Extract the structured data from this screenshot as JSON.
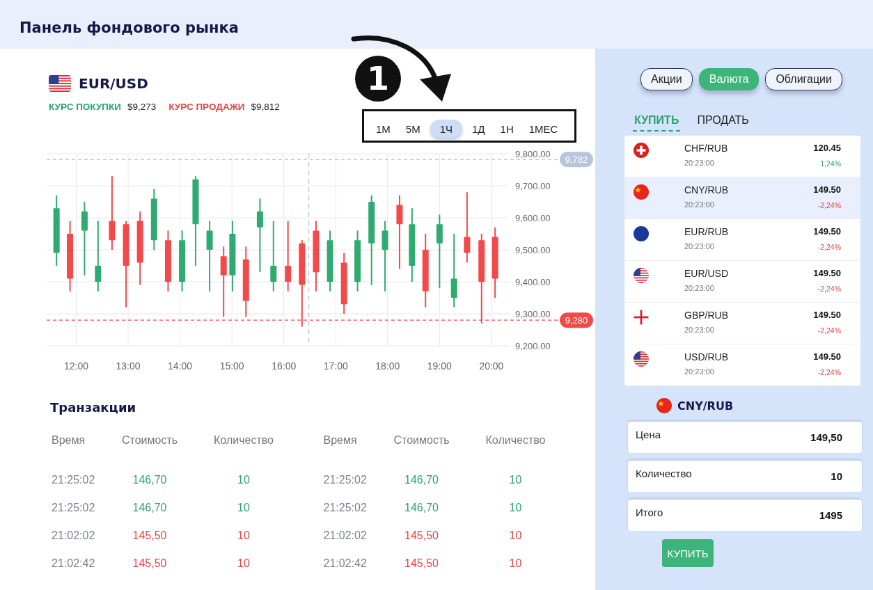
{
  "header": {
    "title": "Панель фондового рынка"
  },
  "instrument": {
    "pair": "EUR/USD",
    "kind": "us",
    "buy_label": "КУРС ПОКУПКИ",
    "buy_rate": "$9,273",
    "sell_label": "КУРС ПРОДАЖИ",
    "sell_rate": "$9,812"
  },
  "callout": {
    "number": "1"
  },
  "timeframes": [
    {
      "label": "1М",
      "selected": false
    },
    {
      "label": "5М",
      "selected": false
    },
    {
      "label": "1Ч",
      "selected": true
    },
    {
      "label": "1Д",
      "selected": false
    },
    {
      "label": "1Н",
      "selected": false
    },
    {
      "label": "1МЕС",
      "selected": false
    }
  ],
  "chart": {
    "chart_data": {
      "type": "candlestick",
      "x": [
        11.62,
        11.88,
        12.16,
        12.42,
        12.69,
        12.96,
        13.23,
        13.5,
        13.77,
        14.04,
        14.3,
        14.57,
        14.84,
        15.01,
        15.27,
        15.54,
        15.8,
        16.08,
        16.35,
        16.62,
        16.89,
        17.16,
        17.42,
        17.69,
        17.95,
        18.23,
        18.47,
        18.73,
        19.0,
        19.28,
        19.53,
        19.81,
        20.07
      ],
      "ohlc": [
        [
          9490,
          9670,
          9450,
          9630
        ],
        [
          9550,
          9590,
          9370,
          9410
        ],
        [
          9560,
          9650,
          9420,
          9620
        ],
        [
          9400,
          9590,
          9370,
          9450
        ],
        [
          9590,
          9730,
          9500,
          9530
        ],
        [
          9580,
          9590,
          9320,
          9450
        ],
        [
          9590,
          9620,
          9390,
          9460
        ],
        [
          9530,
          9690,
          9500,
          9660
        ],
        [
          9530,
          9560,
          9370,
          9400
        ],
        [
          9400,
          9560,
          9370,
          9530
        ],
        [
          9580,
          9730,
          9450,
          9720
        ],
        [
          9500,
          9590,
          9370,
          9560
        ],
        [
          9480,
          9510,
          9290,
          9420
        ],
        [
          9420,
          9590,
          9370,
          9550
        ],
        [
          9470,
          9510,
          9290,
          9340
        ],
        [
          9570,
          9660,
          9430,
          9620
        ],
        [
          9400,
          9590,
          9370,
          9450
        ],
        [
          9450,
          9590,
          9370,
          9400
        ],
        [
          9520,
          9530,
          9260,
          9390
        ],
        [
          9560,
          9590,
          9370,
          9430
        ],
        [
          9400,
          9560,
          9370,
          9530
        ],
        [
          9460,
          9490,
          9300,
          9330
        ],
        [
          9400,
          9560,
          9370,
          9530
        ],
        [
          9520,
          9670,
          9390,
          9650
        ],
        [
          9500,
          9590,
          9370,
          9560
        ],
        [
          9640,
          9670,
          9440,
          9580
        ],
        [
          9450,
          9630,
          9400,
          9580
        ],
        [
          9500,
          9550,
          9320,
          9370
        ],
        [
          9520,
          9610,
          9380,
          9580
        ],
        [
          9350,
          9550,
          9320,
          9410
        ],
        [
          9540,
          9680,
          9460,
          9490
        ],
        [
          9530,
          9550,
          9270,
          9400
        ],
        [
          9540,
          9570,
          9350,
          9410
        ]
      ],
      "xlim": [
        11.43,
        20.35
      ],
      "ylim": [
        9200,
        9800
      ],
      "grid": true,
      "xticks": [
        {
          "value": 12,
          "label": "12:00"
        },
        {
          "value": 13,
          "label": "13:00"
        },
        {
          "value": 14,
          "label": "14:00"
        },
        {
          "value": 15,
          "label": "15:00"
        },
        {
          "value": 16,
          "label": "16:00"
        },
        {
          "value": 17,
          "label": "17:00"
        },
        {
          "value": 18,
          "label": "18:00"
        },
        {
          "value": 19,
          "label": "19:00"
        },
        {
          "value": 20,
          "label": "20:00"
        }
      ],
      "yticks": [
        {
          "value": 9200,
          "label": "9,200.00"
        },
        {
          "value": 9300,
          "label": "9,300.00"
        },
        {
          "value": 9400,
          "label": "9,400.00"
        },
        {
          "value": 9500,
          "label": "9,500.00"
        },
        {
          "value": 9600,
          "label": "9,600.00"
        },
        {
          "value": 9700,
          "label": "9,700.00"
        },
        {
          "value": 9800,
          "label": "9,800.00"
        }
      ],
      "ref_lines": [
        {
          "axis": "y",
          "value": 9782,
          "label": "9,782",
          "color": "#b9c5dd"
        },
        {
          "axis": "y",
          "value": 9280,
          "label": "9,280",
          "color": "#f24a4a"
        },
        {
          "axis": "x",
          "value": 16.48,
          "color": "#c8ccd6"
        }
      ]
    }
  },
  "transactions": {
    "title": "Транзакции",
    "tables": [
      {
        "columns": [
          "Время",
          "Стоимость",
          "Количество"
        ],
        "rows": [
          {
            "time": "21:25:02",
            "price": "146,70",
            "quantity": "10",
            "kind": "buy"
          },
          {
            "time": "21:25:02",
            "price": "146,70",
            "quantity": "10",
            "kind": "buy"
          },
          {
            "time": "21:02:02",
            "price": "145,50",
            "quantity": "10",
            "kind": "sell"
          },
          {
            "time": "21:02:42",
            "price": "145,50",
            "quantity": "10",
            "kind": "sell"
          }
        ]
      },
      {
        "columns": [
          "Время",
          "Стоимость",
          "Количество"
        ],
        "rows": [
          {
            "time": "21:25:02",
            "price": "146,70",
            "quantity": "10",
            "kind": "buy"
          },
          {
            "time": "21:25:02",
            "price": "146,70",
            "quantity": "10",
            "kind": "buy"
          },
          {
            "time": "21:02:02",
            "price": "145,50",
            "quantity": "10",
            "kind": "sell"
          },
          {
            "time": "21:02:42",
            "price": "145,50",
            "quantity": "10",
            "kind": "sell"
          }
        ]
      }
    ]
  },
  "market_tabs": [
    {
      "label": "Акции",
      "selected": false
    },
    {
      "label": "Валюта",
      "selected": true
    },
    {
      "label": "Облигации",
      "selected": false
    }
  ],
  "trade_tabs": [
    {
      "label": "КУПИТЬ",
      "selected": true
    },
    {
      "label": "ПРОДАТЬ",
      "selected": false
    }
  ],
  "quotes": [
    {
      "pair": "CHF/RUB",
      "kind": "ch",
      "time": "20:23:00",
      "price": "120.45",
      "change": "1,24%",
      "rising": true,
      "selected": false
    },
    {
      "pair": "CNY/RUB",
      "kind": "cn",
      "time": "20:23:00",
      "price": "149.50",
      "change": "-2,24%",
      "rising": false,
      "selected": true
    },
    {
      "pair": "EUR/RUB",
      "kind": "eu",
      "time": "20:23:00",
      "price": "149.50",
      "change": "-2,24%",
      "rising": false,
      "selected": false
    },
    {
      "pair": "EUR/USD",
      "kind": "us",
      "time": "20:23:00",
      "price": "149.50",
      "change": "-2,24%",
      "rising": false,
      "selected": false
    },
    {
      "pair": "GBP/RUB",
      "kind": "gb",
      "time": "20:23:00",
      "price": "149.50",
      "change": "-2,24%",
      "rising": false,
      "selected": false
    },
    {
      "pair": "USD/RUB",
      "kind": "us",
      "time": "20:23:00",
      "price": "149.50",
      "change": "-2,24%",
      "rising": false,
      "selected": false
    }
  ],
  "order": {
    "pair": "CNY/RUB",
    "kind": "cn",
    "fields": [
      {
        "label": "Цена",
        "value": "149,50"
      },
      {
        "label": "Количество",
        "value": "10"
      },
      {
        "label": "Итого",
        "value": "1495"
      }
    ],
    "button": "КУПИТЬ"
  }
}
